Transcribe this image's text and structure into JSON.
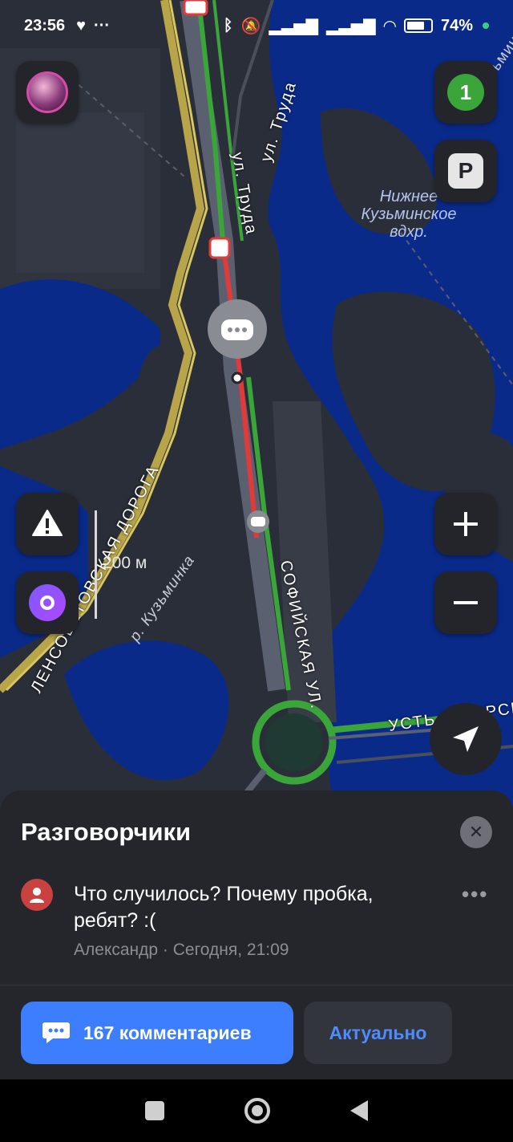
{
  "status_bar": {
    "time": "23:56",
    "left_icons": [
      "heart-icon",
      "more-dots-icon"
    ],
    "battery_percent": 74,
    "battery_label": "74%",
    "right_icons": [
      "bluetooth-icon",
      "mute-icon",
      "signal-icon",
      "signal-icon",
      "wifi-icon",
      "battery-icon"
    ]
  },
  "map": {
    "labels": {
      "ul_truda_1": "ул. Труда",
      "ul_truda_2": "ул. Труда",
      "kuzminka_top": "р. Кузьминка",
      "reservoir": "Нижнее Кузьминское вдхр.",
      "reservoir_line1": "Нижнее",
      "reservoir_line2": "Кузьминское",
      "reservoir_line3": "вдхр.",
      "lensovet": "ЛЕНСОВЕТОВСКАЯ ДОРОГА",
      "kuzminka_river": "р. Кузьминка",
      "sofiyskaya": "СОФИЙСКАЯ УЛ.",
      "ust_izhorskoe": "УСТЬ-ИЖОРСКОЕ"
    },
    "scale": "200 м",
    "traffic_level": "1",
    "parking_label": "P",
    "colors": {
      "water": "#0a2a8a",
      "land": "#2a2e38",
      "traffic_green": "#3aa63a",
      "traffic_red": "#e03a3a",
      "road_yellow": "#b8a54a"
    }
  },
  "sheet": {
    "title": "Разговорчики",
    "comment": {
      "text": "Что случилось? Почему пробка, ребят? :(",
      "author": "Александр",
      "time": "Сегодня, 21:09",
      "meta": "Александр · Сегодня, 21:09"
    },
    "buttons": {
      "comments": "167 комментариев",
      "actual": "Актуально"
    }
  }
}
